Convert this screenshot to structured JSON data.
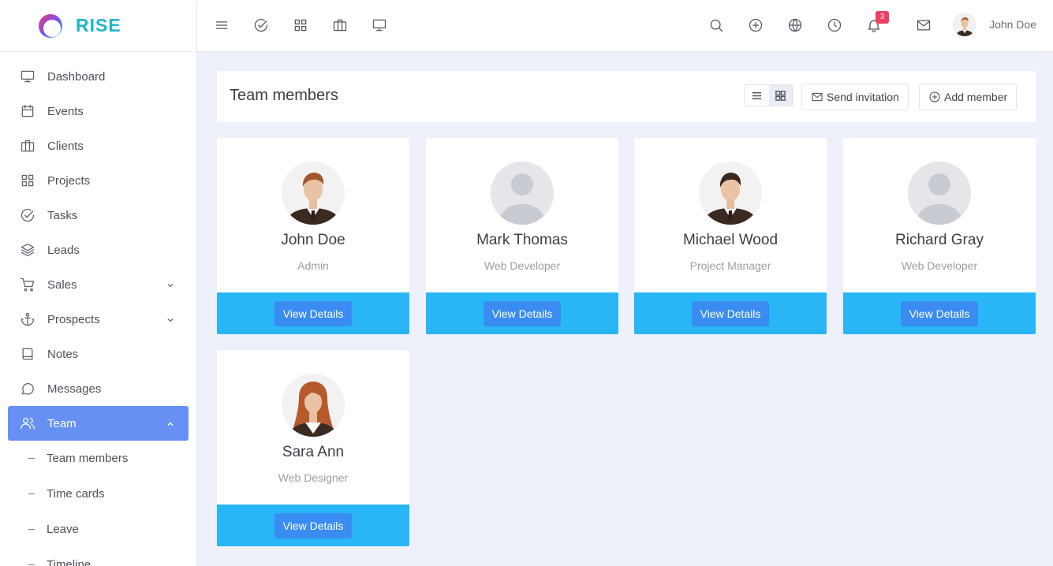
{
  "brand": {
    "name": "RISE"
  },
  "sidebar": {
    "items": [
      {
        "label": "Dashboard",
        "icon": "monitor-icon"
      },
      {
        "label": "Events",
        "icon": "calendar-icon"
      },
      {
        "label": "Clients",
        "icon": "briefcase-icon"
      },
      {
        "label": "Projects",
        "icon": "grid-icon"
      },
      {
        "label": "Tasks",
        "icon": "check-circle-icon"
      },
      {
        "label": "Leads",
        "icon": "layers-icon"
      },
      {
        "label": "Sales",
        "icon": "cart-icon"
      },
      {
        "label": "Prospects",
        "icon": "anchor-icon"
      },
      {
        "label": "Notes",
        "icon": "book-icon"
      },
      {
        "label": "Messages",
        "icon": "message-icon"
      },
      {
        "label": "Team",
        "icon": "users-icon"
      }
    ],
    "team_sub": [
      "Team members",
      "Time cards",
      "Leave",
      "Timeline"
    ]
  },
  "topbar": {
    "notifications_count": "3",
    "user_name": "John Doe"
  },
  "page": {
    "title": "Team members",
    "send_invitation": "Send invitation",
    "add_member": "Add member"
  },
  "members": [
    {
      "name": "John Doe",
      "role": "Admin",
      "button": "View Details"
    },
    {
      "name": "Mark Thomas",
      "role": "Web Developer",
      "button": "View Details"
    },
    {
      "name": "Michael Wood",
      "role": "Project Manager",
      "button": "View Details"
    },
    {
      "name": "Richard Gray",
      "role": "Web Developer",
      "button": "View Details"
    },
    {
      "name": "Sara Ann",
      "role": "Web Designer",
      "button": "View Details"
    }
  ],
  "colors": {
    "brand": "#1fb5c9",
    "active_nav": "#6690f4",
    "card_footer": "#28b6f6",
    "button": "#3a8cf2",
    "badge": "#ef3f62"
  }
}
